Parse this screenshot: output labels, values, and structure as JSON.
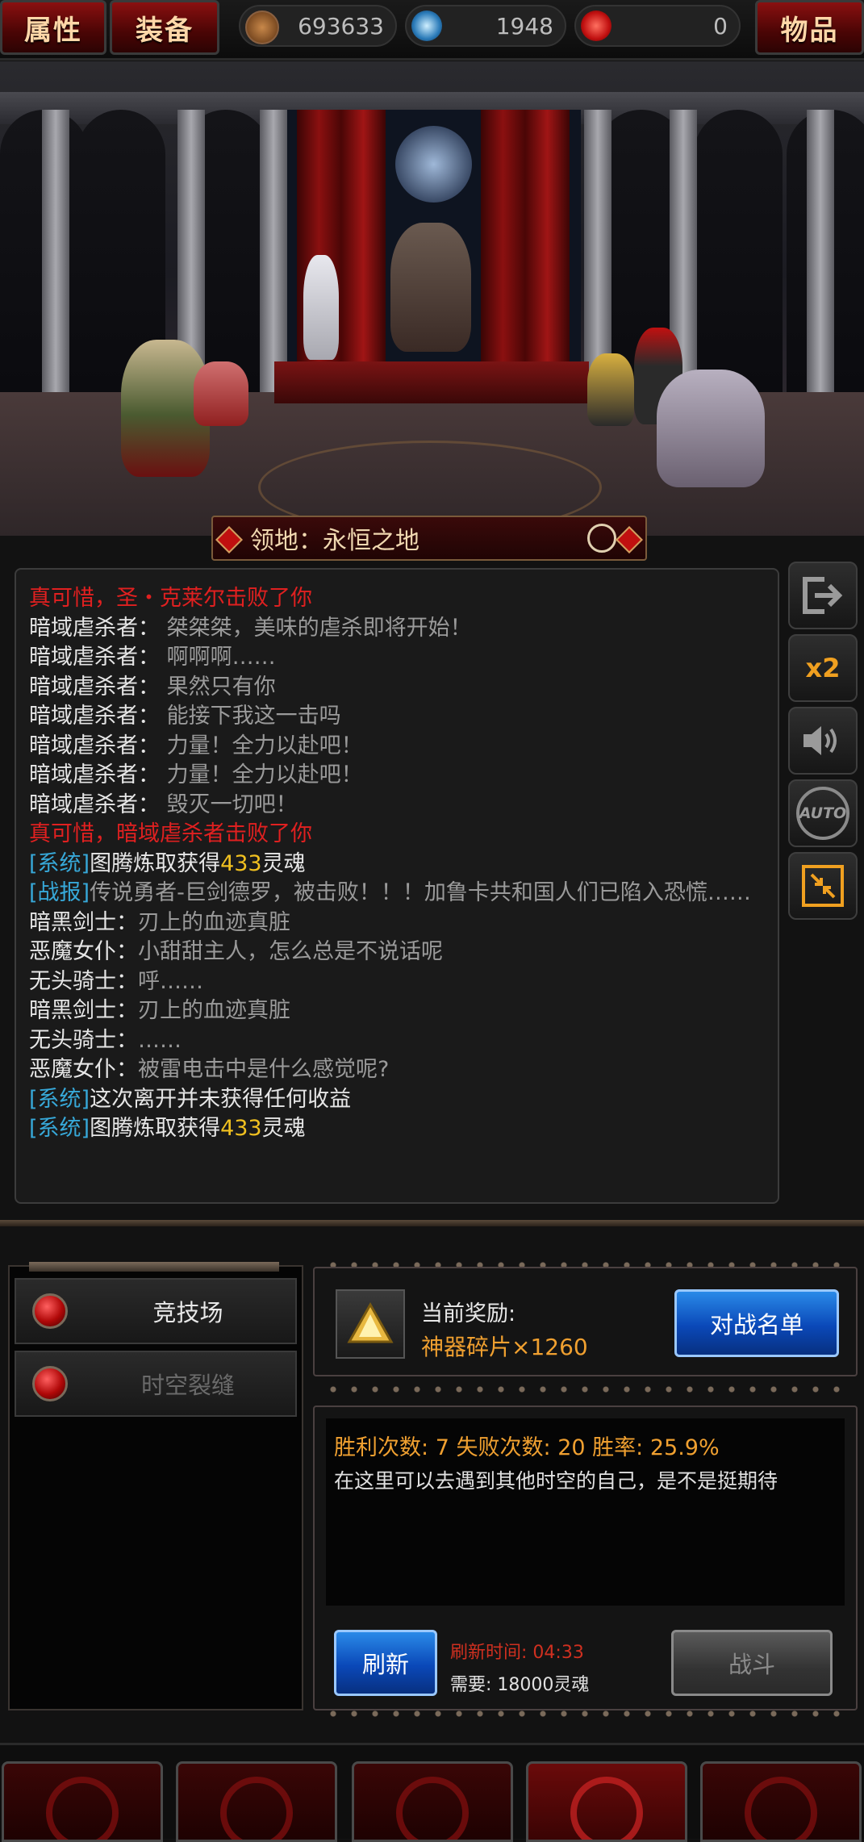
{
  "topbar": {
    "attr_label": "属性",
    "equip_label": "装备",
    "items_label": "物品",
    "currencies": [
      {
        "icon": "star-coin-icon",
        "value": "693633"
      },
      {
        "icon": "blue-skull-gem-icon",
        "value": "1948"
      },
      {
        "icon": "red-emblem-icon",
        "value": "0"
      }
    ]
  },
  "zone": {
    "label": "领地：永恒之地"
  },
  "log": [
    {
      "type": "red",
      "text": "真可惜，圣・克莱尔击败了你"
    },
    {
      "type": "talk",
      "speaker": "暗域虐杀者：",
      "text": "桀桀桀，美味的虐杀即将开始！"
    },
    {
      "type": "talk",
      "speaker": "暗域虐杀者：",
      "text": "啊啊啊……"
    },
    {
      "type": "talk",
      "speaker": "暗域虐杀者：",
      "text": "果然只有你"
    },
    {
      "type": "talk",
      "speaker": "暗域虐杀者：",
      "text": "能接下我这一击吗"
    },
    {
      "type": "talk",
      "speaker": "暗域虐杀者：",
      "text": "力量！全力以赴吧！"
    },
    {
      "type": "talk",
      "speaker": "暗域虐杀者：",
      "text": "力量！全力以赴吧！"
    },
    {
      "type": "talk",
      "speaker": "暗域虐杀者：",
      "text": "毁灭一切吧！"
    },
    {
      "type": "red",
      "text": "真可惜，暗域虐杀者击败了你"
    },
    {
      "type": "system",
      "tag": "[系统]",
      "pre": "图腾炼取获得",
      "num": "433",
      "post": "灵魂"
    },
    {
      "type": "report",
      "tag": "[战报]",
      "text": "传说勇者-巨剑德罗，被击败！！！加鲁卡共和国人们已陷入恐慌……"
    },
    {
      "type": "talk",
      "speaker": "暗黑剑士：",
      "text": "刃上的血迹真脏"
    },
    {
      "type": "talk",
      "speaker": "恶魔女仆：",
      "text": "小甜甜主人，怎么总是不说话呢"
    },
    {
      "type": "talk",
      "speaker": "无头骑士：",
      "text": "呼……"
    },
    {
      "type": "talk",
      "speaker": "暗黑剑士：",
      "text": "刃上的血迹真脏"
    },
    {
      "type": "talk",
      "speaker": "无头骑士：",
      "text": "……"
    },
    {
      "type": "talk",
      "speaker": "恶魔女仆：",
      "text": "被雷电击中是什么感觉呢?"
    },
    {
      "type": "system2",
      "tag": "[系统]",
      "text": "这次离开并未获得任何收益"
    },
    {
      "type": "system",
      "tag": "[系统]",
      "pre": "图腾炼取获得",
      "num": "433",
      "post": "灵魂"
    }
  ],
  "side_buttons": {
    "exit_icon": "exit-icon",
    "speed_label": "x2",
    "sound_icon": "speaker-icon",
    "auto_label": "AUTO",
    "shrink_icon": "shrink-icon"
  },
  "modes": [
    {
      "label": "竞技场",
      "active": true
    },
    {
      "label": "时空裂缝",
      "active": false
    }
  ],
  "reward": {
    "title": "当前奖励:",
    "item": "神器碎片×1260",
    "battle_list_label": "对战名单"
  },
  "stats": {
    "wins_label": "胜利次数:",
    "wins": "7",
    "losses_label": "失败次数:",
    "losses": "20",
    "rate_label": "胜率:",
    "rate": "25.9%",
    "description": "在这里可以去遇到其他时空的自己，是不是挺期待"
  },
  "actions": {
    "refresh_label": "刷新",
    "refresh_time_label": "刷新时间:",
    "refresh_time": "04:33",
    "cost_label": "需要:",
    "cost": "18000灵魂",
    "fight_label": "战斗"
  },
  "colors": {
    "accent_red": "#e02020",
    "system_blue": "#37a8d8",
    "gold": "#f0c020",
    "orange": "#f0a030"
  }
}
